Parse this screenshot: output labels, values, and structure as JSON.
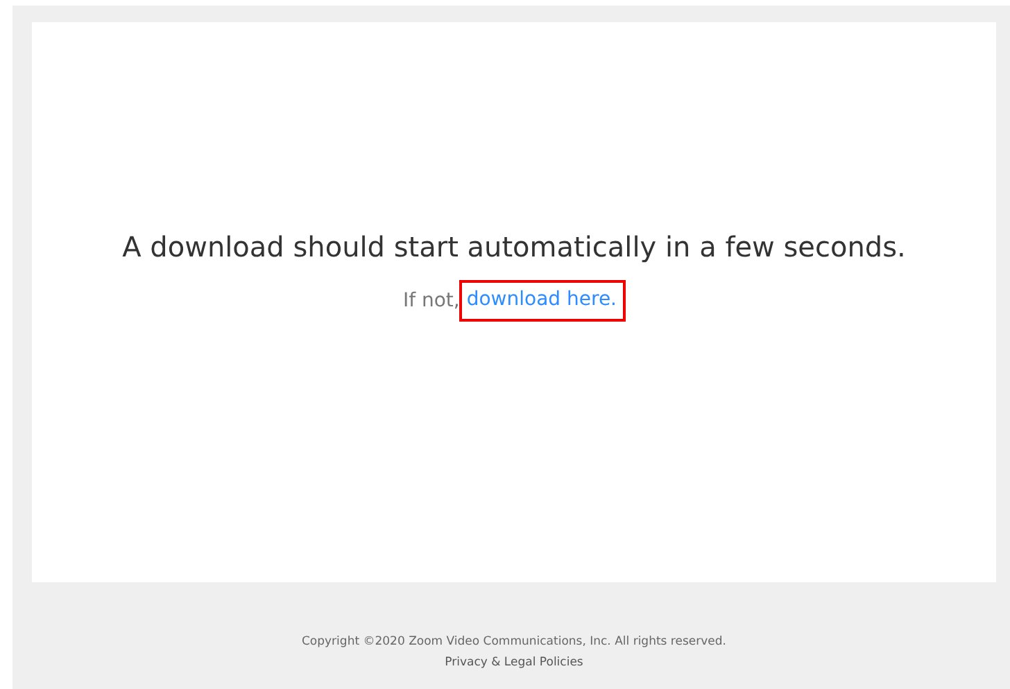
{
  "message": {
    "heading": "A download should start automatically in a few seconds.",
    "fallback_prefix": "If not,",
    "fallback_link": {
      "label": "download here.",
      "highlighted": true
    }
  },
  "footer": {
    "copyright": "Copyright ©2020 Zoom Video Communications, Inc. All rights reserved.",
    "policies_link": "Privacy & Legal Policies"
  }
}
